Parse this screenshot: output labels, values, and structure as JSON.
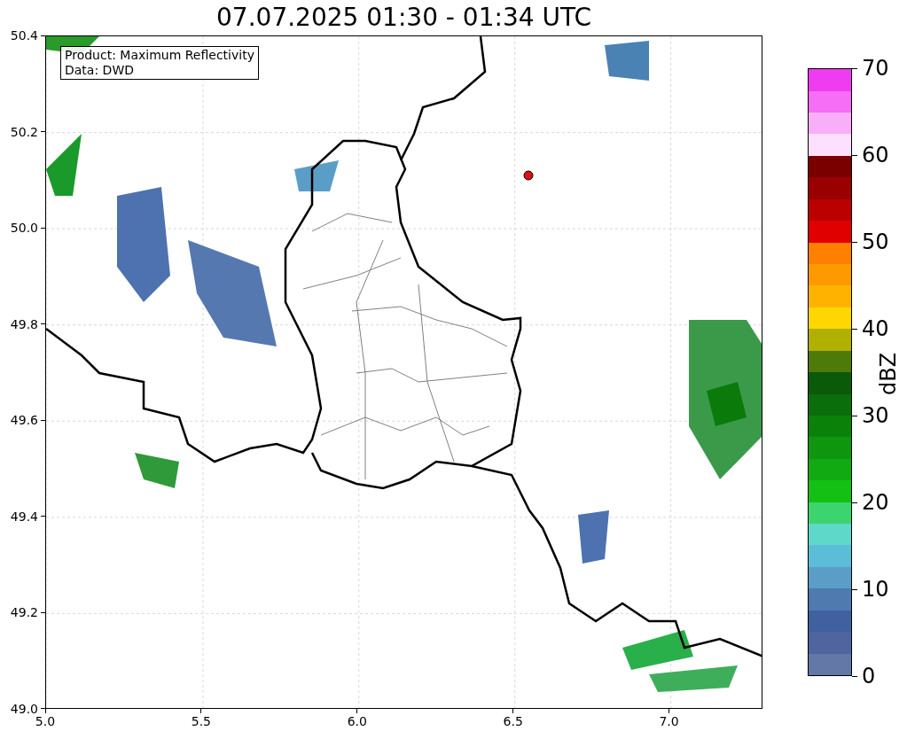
{
  "title": "07.07.2025 01:30 - 01:34 UTC",
  "legend": [
    "Product: Maximum Reflectivity",
    "Data: DWD"
  ],
  "x_ticks": [
    "5.0",
    "5.5",
    "6.0",
    "6.5",
    "7.0"
  ],
  "y_ticks": [
    "50.4",
    "50.2",
    "50.0",
    "49.8",
    "49.6",
    "49.4",
    "49.2",
    "49.0"
  ],
  "colorbar": {
    "label": "dBZ",
    "ticks": [
      "70",
      "60",
      "50",
      "40",
      "30",
      "20",
      "10",
      "0"
    ],
    "segments": [
      {
        "color": "#6478a8"
      },
      {
        "color": "#5065a0"
      },
      {
        "color": "#4060a0"
      },
      {
        "color": "#4e7ab0"
      },
      {
        "color": "#5a9ec8"
      },
      {
        "color": "#5bbdd8"
      },
      {
        "color": "#5ed8c8"
      },
      {
        "color": "#3cd46e"
      },
      {
        "color": "#15c015"
      },
      {
        "color": "#12aa12"
      },
      {
        "color": "#0f960f"
      },
      {
        "color": "#0a820a"
      },
      {
        "color": "#0a6e0a"
      },
      {
        "color": "#0a5a0a"
      },
      {
        "color": "#4e7a0a"
      },
      {
        "color": "#b0b000"
      },
      {
        "color": "#ffd700"
      },
      {
        "color": "#ffb300"
      },
      {
        "color": "#ff9900"
      },
      {
        "color": "#ff7f00"
      },
      {
        "color": "#e00000"
      },
      {
        "color": "#bb0000"
      },
      {
        "color": "#9a0000"
      },
      {
        "color": "#7a0000"
      },
      {
        "color": "#fde0fd"
      },
      {
        "color": "#f9aef9"
      },
      {
        "color": "#f56ef5"
      },
      {
        "color": "#f03cf0"
      }
    ]
  }
}
